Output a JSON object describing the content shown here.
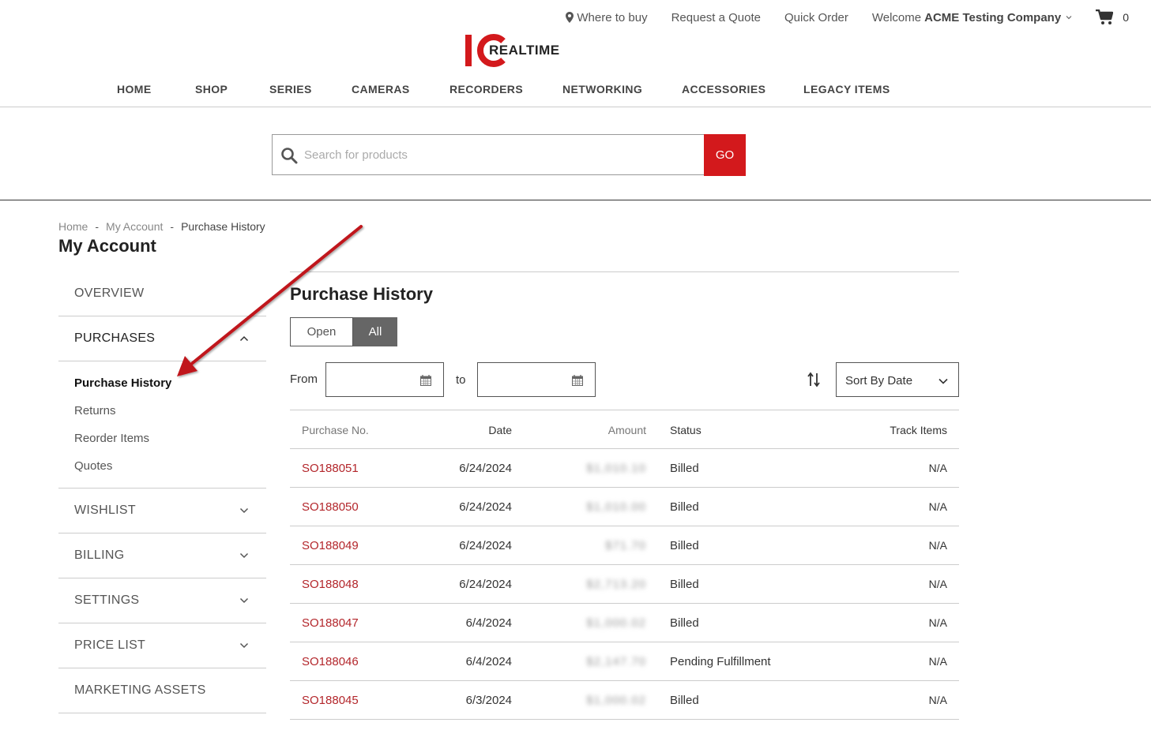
{
  "header": {
    "top_links": {
      "where_to_buy": "Where to buy",
      "request_quote": "Request a Quote",
      "quick_order": "Quick Order",
      "welcome_prefix": "Welcome",
      "company_name": "ACME Testing Company",
      "cart_count": "0"
    },
    "logo_text": "REALTIME",
    "brand_color": "#d3191c"
  },
  "nav": {
    "items": [
      "HOME",
      "SHOP",
      "SERIES",
      "CAMERAS",
      "RECORDERS",
      "NETWORKING",
      "ACCESSORIES",
      "LEGACY ITEMS"
    ]
  },
  "search": {
    "placeholder": "Search for products",
    "value": "",
    "go_label": "GO"
  },
  "breadcrumb": [
    "Home",
    "My Account",
    "Purchase History"
  ],
  "page_title": "My Account",
  "sidebar": {
    "overview": "OVERVIEW",
    "purchases": "PURCHASES",
    "purchases_items": [
      "Purchase History",
      "Returns",
      "Reorder Items",
      "Quotes"
    ],
    "wishlist": "WISHLIST",
    "billing": "BILLING",
    "settings": "SETTINGS",
    "price_list": "PRICE LIST",
    "marketing_assets": "MARKETING ASSETS"
  },
  "main": {
    "title": "Purchase History",
    "toggle": {
      "open": "Open",
      "all": "All",
      "selected": "All"
    },
    "filters": {
      "from_label": "From",
      "to_label": "to",
      "from_value": "",
      "to_value": "",
      "sort_value": "Sort By Date"
    },
    "table": {
      "headers": [
        "Purchase No.",
        "Date",
        "Amount",
        "Status",
        "Track Items"
      ],
      "rows": [
        {
          "no": "SO188051",
          "date": "6/24/2024",
          "amount": "$1,010.10",
          "status": "Billed",
          "track": "N/A"
        },
        {
          "no": "SO188050",
          "date": "6/24/2024",
          "amount": "$1,010.00",
          "status": "Billed",
          "track": "N/A"
        },
        {
          "no": "SO188049",
          "date": "6/24/2024",
          "amount": "$71.70",
          "status": "Billed",
          "track": "N/A"
        },
        {
          "no": "SO188048",
          "date": "6/24/2024",
          "amount": "$2,713.20",
          "status": "Billed",
          "track": "N/A"
        },
        {
          "no": "SO188047",
          "date": "6/4/2024",
          "amount": "$1,000.02",
          "status": "Billed",
          "track": "N/A"
        },
        {
          "no": "SO188046",
          "date": "6/4/2024",
          "amount": "$2,147.70",
          "status": "Pending Fulfillment",
          "track": "N/A"
        },
        {
          "no": "SO188045",
          "date": "6/3/2024",
          "amount": "$1,000.02",
          "status": "Billed",
          "track": "N/A"
        }
      ]
    }
  },
  "colors": {
    "link_red": "#b3262b",
    "arrow_red": "#c0161b",
    "toggle_active": "#666666"
  }
}
